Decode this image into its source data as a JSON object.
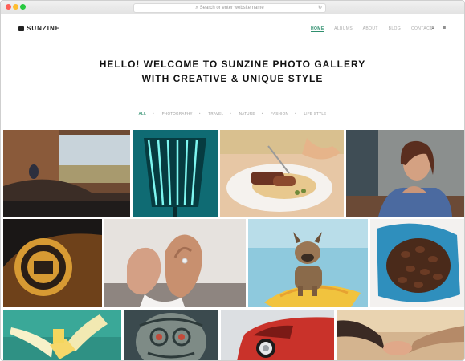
{
  "browser": {
    "url_placeholder": "Search or enter website name"
  },
  "site": {
    "logo": "SUNZINE",
    "menu": [
      "HOME",
      "ALBUMS",
      "ABOUT",
      "BLOG",
      "CONTACT"
    ],
    "active_menu": "HOME"
  },
  "hero": {
    "line1": "HELLO! WELCOME TO SUNZINE PHOTO GALLERY",
    "line2": "WITH CREATIVE & UNIQUE STYLE"
  },
  "filters": [
    "ALL",
    "PHOTOGRAPHY",
    "TRAVEL",
    "NATURE",
    "FASHION",
    "LIFE STYLE"
  ],
  "active_filter": "ALL",
  "photos": [
    {
      "subject": "modern-interior-window-landscape",
      "color": "#8a5a3a"
    },
    {
      "subject": "teal-striped-lamp",
      "color": "#1e8f96"
    },
    {
      "subject": "steak-dinner-plate",
      "color": "#d9b48a"
    },
    {
      "subject": "woman-portrait-blue-shirt",
      "color": "#5c6f7a"
    },
    {
      "subject": "branded-dark-circle",
      "color": "#2a2522"
    },
    {
      "subject": "hands-ring",
      "color": "#c8b7a6"
    },
    {
      "subject": "french-bulldog-on-paddleboard",
      "color": "#7fc0d6"
    },
    {
      "subject": "coffee-beans-bag",
      "color": "#5aa4c8"
    },
    {
      "subject": "banana-peel-blue",
      "color": "#3bb2a5"
    },
    {
      "subject": "tattoo-pattern",
      "color": "#5a6a6a"
    },
    {
      "subject": "red-car-headlight",
      "color": "#c9322a"
    },
    {
      "subject": "holding-hands-sunset",
      "color": "#c9a882"
    }
  ]
}
